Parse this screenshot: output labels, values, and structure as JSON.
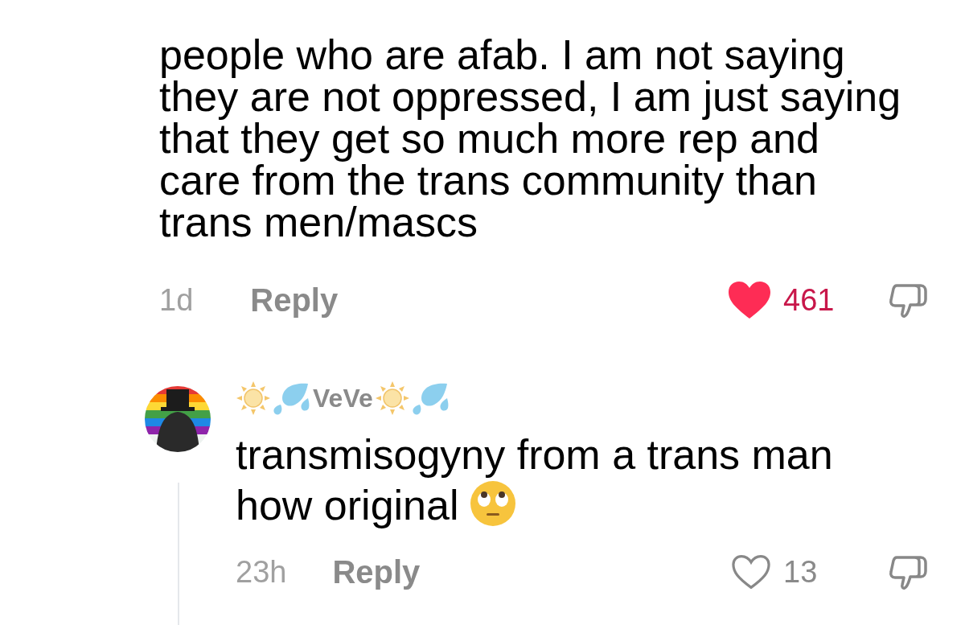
{
  "comments": [
    {
      "text": "people who are afab. I am not saying they are not oppressed, I am just saying that they get so much more rep and care from the trans community than trans men/mascs",
      "emoji_after_text": false,
      "age": "1d",
      "reply_label": "Reply",
      "liked": true,
      "likes": "461",
      "is_reply": false
    },
    {
      "username": "VeVe",
      "text": "transmisogyny from a trans man how original",
      "emoji_after_text": true,
      "age": "23h",
      "reply_label": "Reply",
      "liked": false,
      "likes": "13",
      "is_reply": true
    }
  ]
}
